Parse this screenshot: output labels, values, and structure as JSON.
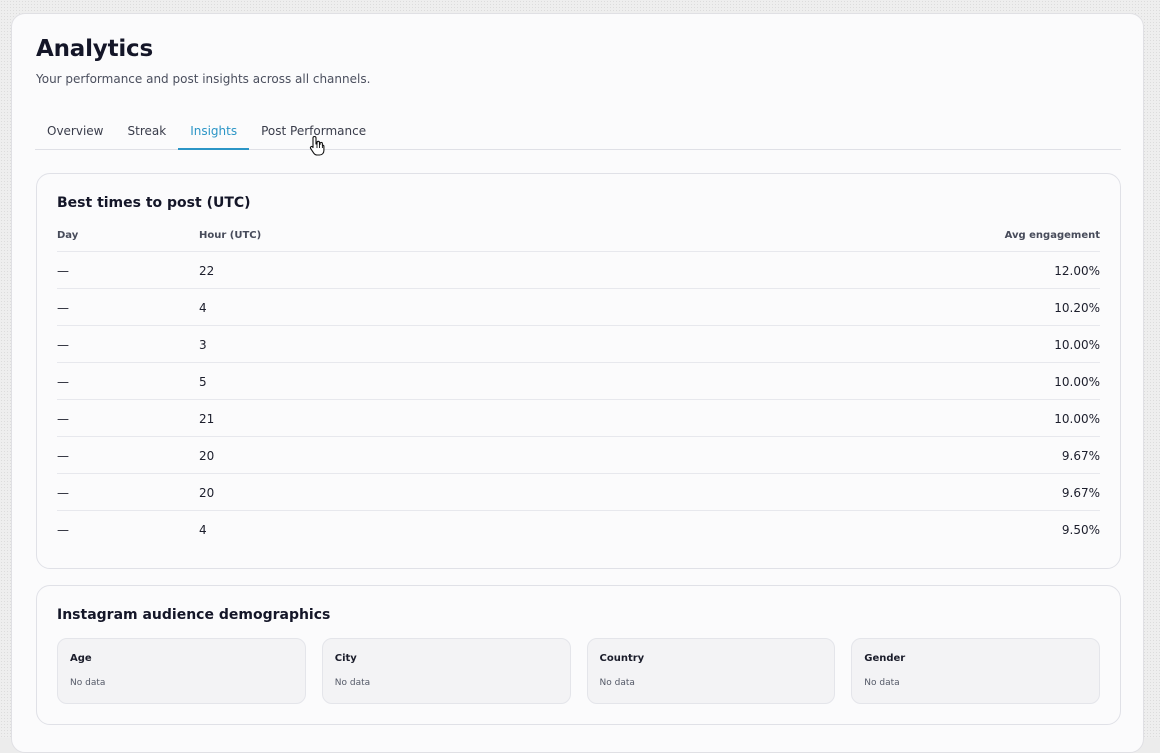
{
  "page": {
    "title": "Analytics",
    "subtitle": "Your performance and post insights across all channels."
  },
  "tabs": [
    {
      "label": "Overview",
      "active": false
    },
    {
      "label": "Streak",
      "active": false
    },
    {
      "label": "Insights",
      "active": true
    },
    {
      "label": "Post Performance",
      "active": false
    }
  ],
  "best_times": {
    "title": "Best times to post (UTC)",
    "columns": {
      "day": "Day",
      "hour": "Hour (UTC)",
      "engagement": "Avg engagement"
    },
    "rows": [
      {
        "day": "—",
        "hour": "22",
        "engagement": "12.00%"
      },
      {
        "day": "—",
        "hour": "4",
        "engagement": "10.20%"
      },
      {
        "day": "—",
        "hour": "3",
        "engagement": "10.00%"
      },
      {
        "day": "—",
        "hour": "5",
        "engagement": "10.00%"
      },
      {
        "day": "—",
        "hour": "21",
        "engagement": "10.00%"
      },
      {
        "day": "—",
        "hour": "20",
        "engagement": "9.67%"
      },
      {
        "day": "—",
        "hour": "20",
        "engagement": "9.67%"
      },
      {
        "day": "—",
        "hour": "4",
        "engagement": "9.50%"
      }
    ]
  },
  "demographics": {
    "title": "Instagram audience demographics",
    "boxes": [
      {
        "label": "Age",
        "value": "No data"
      },
      {
        "label": "City",
        "value": "No data"
      },
      {
        "label": "Country",
        "value": "No data"
      },
      {
        "label": "Gender",
        "value": "No data"
      }
    ]
  },
  "colors": {
    "accent": "#2b95c6",
    "text": "#141628"
  },
  "icons": {
    "cursor": "hand-pointer-icon"
  }
}
